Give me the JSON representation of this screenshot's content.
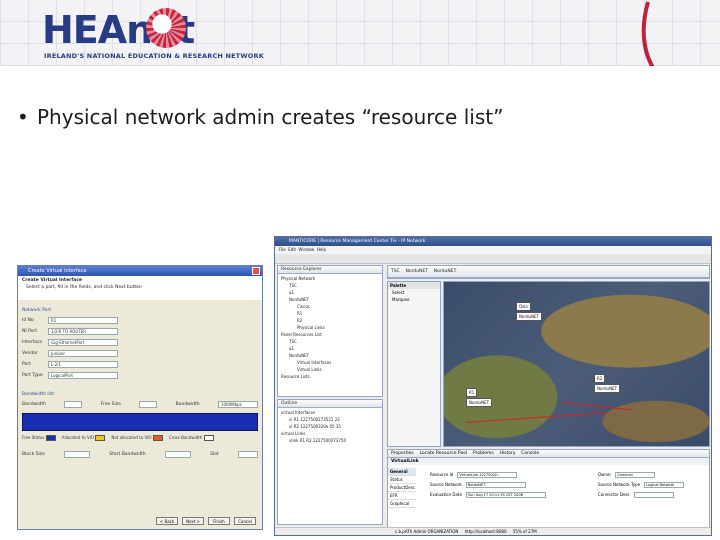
{
  "header": {
    "logo_text": "HEAnet",
    "logo_subtitle": "IRELAND'S NATIONAL EDUCATION & RESEARCH NETWORK"
  },
  "slide": {
    "bullet_text": "Physical network admin creates “resource list”"
  },
  "dialog": {
    "title": "Create Virtual Interface",
    "heading": "Create Virtual Interface",
    "subheading": "Select a port, fill in the fields, and click Next button",
    "section1": "Network Port",
    "fields": [
      {
        "label": "Id No",
        "value": "R1"
      },
      {
        "label": "NI Port",
        "value": "1/2/0 TO ROUTER"
      },
      {
        "label": "Interface",
        "value": "Gig-EthernetPort"
      },
      {
        "label": "Vendor",
        "value": "Juniper"
      },
      {
        "label": "Port",
        "value": "L-2/1"
      },
      {
        "label": "Port Type",
        "value": "LogicalPort"
      }
    ],
    "section2": "Bandwidth list",
    "bw_labels": [
      "Bandwidth",
      "Free Size",
      "Bandwidth"
    ],
    "bw_values": [
      "",
      "",
      "1000Mbps"
    ],
    "legend": [
      "Free Status",
      "Allocated to VIO",
      "Not allocated to VIO",
      "Cross Bandwidth"
    ],
    "legend_colors": [
      "#1a2fb0",
      "#f0c419",
      "#e45d26",
      "#ffffff"
    ],
    "bottom_labels": [
      "Block Size",
      "Start Bandwidth",
      "Slot"
    ],
    "buttons": [
      "< Back",
      "Next >",
      "Finish",
      "Cancel"
    ]
  },
  "app": {
    "title": "MANTICORE | Resource Management Center Tiv - IP Network",
    "menu": [
      "File",
      "Edit",
      "Window",
      "Help"
    ],
    "explorer_tab": "Resource Explorer",
    "tree": [
      "Physical Network",
      "TSC",
      "a1",
      "NorduNET",
      "Ciscos",
      "R1",
      "R2",
      "Physical Links",
      "Panel Resources List",
      "TSC",
      "a1",
      "NorduNET",
      "Virtual Interfaces",
      "Virtual Links",
      "Resource Lists"
    ],
    "outline_tab": "Outline",
    "outline": [
      "virtual Interfaces",
      "vi R1 1227500273521 22",
      "vi R2 1227500320e 05 35",
      "virtual Links",
      "vlink R1 R2 1227500273750"
    ],
    "editor_tabs": [
      "TSC",
      "NorduNET",
      "NorduNET"
    ],
    "palette": [
      "Palette",
      "Select",
      "Marquee"
    ],
    "map_labels": [
      "Oslo",
      "NorduNET",
      "R2",
      "NorduNET",
      "R1",
      "NorduNET"
    ],
    "props_tabs": [
      "Properties",
      "Locate Resource Pool",
      "Problems",
      "History",
      "Console"
    ],
    "props_title": "VirtualLink",
    "props_side": [
      "General",
      "Status",
      "ProductDesc",
      "EFR",
      "Graphical"
    ],
    "props_rows": [
      {
        "label": "Resource Id",
        "value": "VirtualLink-12275002..."
      },
      {
        "label": "Source Network",
        "value": "NorduNET"
      },
      {
        "label": "Evaluation Date",
        "value": "Sun Aug 17 20:11 55 CET 2008"
      },
      {
        "label": "Owner",
        "value": "Common"
      },
      {
        "label": "Source Network Type",
        "value": "Logical Network"
      },
      {
        "label": "Connector Desc",
        "value": ""
      }
    ],
    "status": [
      "c.b.pATh Admin ORGANIZATION",
      "http://localhost:8080",
      "55% of 27M"
    ]
  }
}
